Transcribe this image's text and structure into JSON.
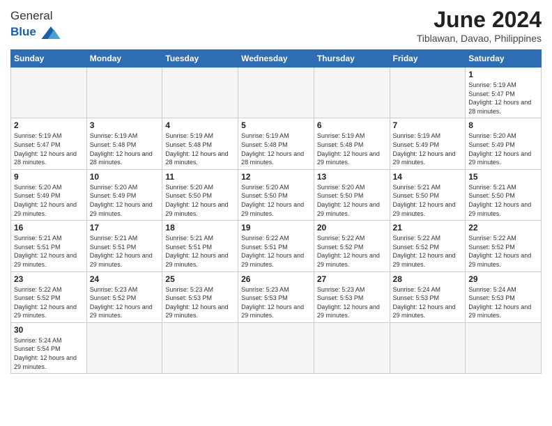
{
  "logo": {
    "text_general": "General",
    "text_blue": "Blue"
  },
  "title": "June 2024",
  "location": "Tiblawan, Davao, Philippines",
  "days_of_week": [
    "Sunday",
    "Monday",
    "Tuesday",
    "Wednesday",
    "Thursday",
    "Friday",
    "Saturday"
  ],
  "weeks": [
    [
      {
        "day": null,
        "info": ""
      },
      {
        "day": null,
        "info": ""
      },
      {
        "day": null,
        "info": ""
      },
      {
        "day": null,
        "info": ""
      },
      {
        "day": null,
        "info": ""
      },
      {
        "day": null,
        "info": ""
      },
      {
        "day": "1",
        "info": "Sunrise: 5:19 AM\nSunset: 5:47 PM\nDaylight: 12 hours and 28 minutes."
      }
    ],
    [
      {
        "day": "2",
        "info": "Sunrise: 5:19 AM\nSunset: 5:47 PM\nDaylight: 12 hours and 28 minutes."
      },
      {
        "day": "3",
        "info": "Sunrise: 5:19 AM\nSunset: 5:48 PM\nDaylight: 12 hours and 28 minutes."
      },
      {
        "day": "4",
        "info": "Sunrise: 5:19 AM\nSunset: 5:48 PM\nDaylight: 12 hours and 28 minutes."
      },
      {
        "day": "5",
        "info": "Sunrise: 5:19 AM\nSunset: 5:48 PM\nDaylight: 12 hours and 28 minutes."
      },
      {
        "day": "6",
        "info": "Sunrise: 5:19 AM\nSunset: 5:48 PM\nDaylight: 12 hours and 29 minutes."
      },
      {
        "day": "7",
        "info": "Sunrise: 5:19 AM\nSunset: 5:49 PM\nDaylight: 12 hours and 29 minutes."
      },
      {
        "day": "8",
        "info": "Sunrise: 5:20 AM\nSunset: 5:49 PM\nDaylight: 12 hours and 29 minutes."
      }
    ],
    [
      {
        "day": "9",
        "info": "Sunrise: 5:20 AM\nSunset: 5:49 PM\nDaylight: 12 hours and 29 minutes."
      },
      {
        "day": "10",
        "info": "Sunrise: 5:20 AM\nSunset: 5:49 PM\nDaylight: 12 hours and 29 minutes."
      },
      {
        "day": "11",
        "info": "Sunrise: 5:20 AM\nSunset: 5:50 PM\nDaylight: 12 hours and 29 minutes."
      },
      {
        "day": "12",
        "info": "Sunrise: 5:20 AM\nSunset: 5:50 PM\nDaylight: 12 hours and 29 minutes."
      },
      {
        "day": "13",
        "info": "Sunrise: 5:20 AM\nSunset: 5:50 PM\nDaylight: 12 hours and 29 minutes."
      },
      {
        "day": "14",
        "info": "Sunrise: 5:21 AM\nSunset: 5:50 PM\nDaylight: 12 hours and 29 minutes."
      },
      {
        "day": "15",
        "info": "Sunrise: 5:21 AM\nSunset: 5:50 PM\nDaylight: 12 hours and 29 minutes."
      }
    ],
    [
      {
        "day": "16",
        "info": "Sunrise: 5:21 AM\nSunset: 5:51 PM\nDaylight: 12 hours and 29 minutes."
      },
      {
        "day": "17",
        "info": "Sunrise: 5:21 AM\nSunset: 5:51 PM\nDaylight: 12 hours and 29 minutes."
      },
      {
        "day": "18",
        "info": "Sunrise: 5:21 AM\nSunset: 5:51 PM\nDaylight: 12 hours and 29 minutes."
      },
      {
        "day": "19",
        "info": "Sunrise: 5:22 AM\nSunset: 5:51 PM\nDaylight: 12 hours and 29 minutes."
      },
      {
        "day": "20",
        "info": "Sunrise: 5:22 AM\nSunset: 5:52 PM\nDaylight: 12 hours and 29 minutes."
      },
      {
        "day": "21",
        "info": "Sunrise: 5:22 AM\nSunset: 5:52 PM\nDaylight: 12 hours and 29 minutes."
      },
      {
        "day": "22",
        "info": "Sunrise: 5:22 AM\nSunset: 5:52 PM\nDaylight: 12 hours and 29 minutes."
      }
    ],
    [
      {
        "day": "23",
        "info": "Sunrise: 5:22 AM\nSunset: 5:52 PM\nDaylight: 12 hours and 29 minutes."
      },
      {
        "day": "24",
        "info": "Sunrise: 5:23 AM\nSunset: 5:52 PM\nDaylight: 12 hours and 29 minutes."
      },
      {
        "day": "25",
        "info": "Sunrise: 5:23 AM\nSunset: 5:53 PM\nDaylight: 12 hours and 29 minutes."
      },
      {
        "day": "26",
        "info": "Sunrise: 5:23 AM\nSunset: 5:53 PM\nDaylight: 12 hours and 29 minutes."
      },
      {
        "day": "27",
        "info": "Sunrise: 5:23 AM\nSunset: 5:53 PM\nDaylight: 12 hours and 29 minutes."
      },
      {
        "day": "28",
        "info": "Sunrise: 5:24 AM\nSunset: 5:53 PM\nDaylight: 12 hours and 29 minutes."
      },
      {
        "day": "29",
        "info": "Sunrise: 5:24 AM\nSunset: 5:53 PM\nDaylight: 12 hours and 29 minutes."
      }
    ],
    [
      {
        "day": "30",
        "info": "Sunrise: 5:24 AM\nSunset: 5:54 PM\nDaylight: 12 hours and 29 minutes."
      },
      {
        "day": null,
        "info": ""
      },
      {
        "day": null,
        "info": ""
      },
      {
        "day": null,
        "info": ""
      },
      {
        "day": null,
        "info": ""
      },
      {
        "day": null,
        "info": ""
      },
      {
        "day": null,
        "info": ""
      }
    ]
  ]
}
